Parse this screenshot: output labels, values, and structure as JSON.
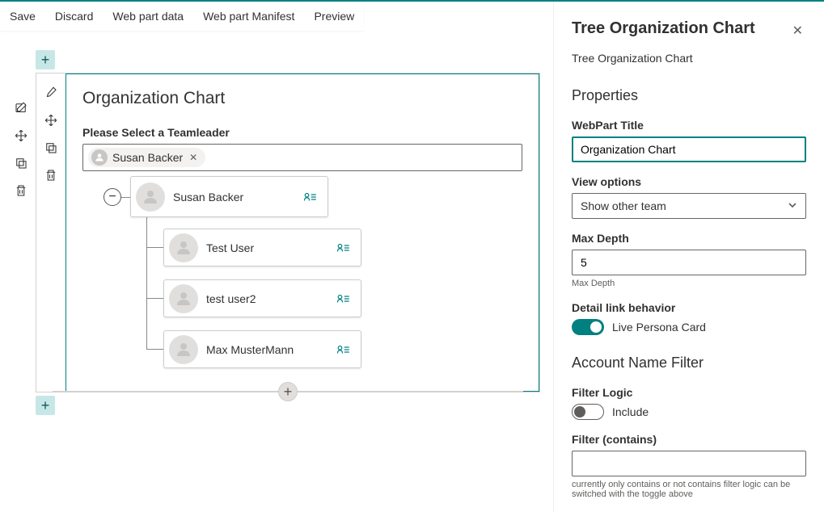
{
  "toolbar": {
    "save": "Save",
    "discard": "Discard",
    "webpart_data": "Web part data",
    "webpart_manifest": "Web part Manifest",
    "preview": "Preview"
  },
  "canvas": {
    "title": "Organization Chart",
    "picker_label": "Please Select a Teamleader",
    "chip_text": "Susan Backer",
    "tree": {
      "root": {
        "name": "Susan Backer"
      },
      "children": [
        {
          "name": "Test User"
        },
        {
          "name": "test user2"
        },
        {
          "name": "Max MusterMann"
        }
      ]
    }
  },
  "panel": {
    "title": "Tree Organization Chart",
    "subtitle": "Tree Organization Chart",
    "section_props": "Properties",
    "webpart_title_label": "WebPart Title",
    "webpart_title_value": "Organization Chart",
    "view_options_label": "View options",
    "view_options_value": "Show other team",
    "max_depth_label": "Max Depth",
    "max_depth_value": "5",
    "max_depth_help": "Max Depth",
    "detail_link_label": "Detail link behavior",
    "detail_link_value": "Live Persona Card",
    "section_filter": "Account Name Filter",
    "filter_logic_label": "Filter Logic",
    "filter_logic_value": "Include",
    "filter_contains_label": "Filter (contains)",
    "filter_contains_value": "",
    "filter_help": "currently only contains or not contains filter logic can be switched with the toggle above"
  }
}
